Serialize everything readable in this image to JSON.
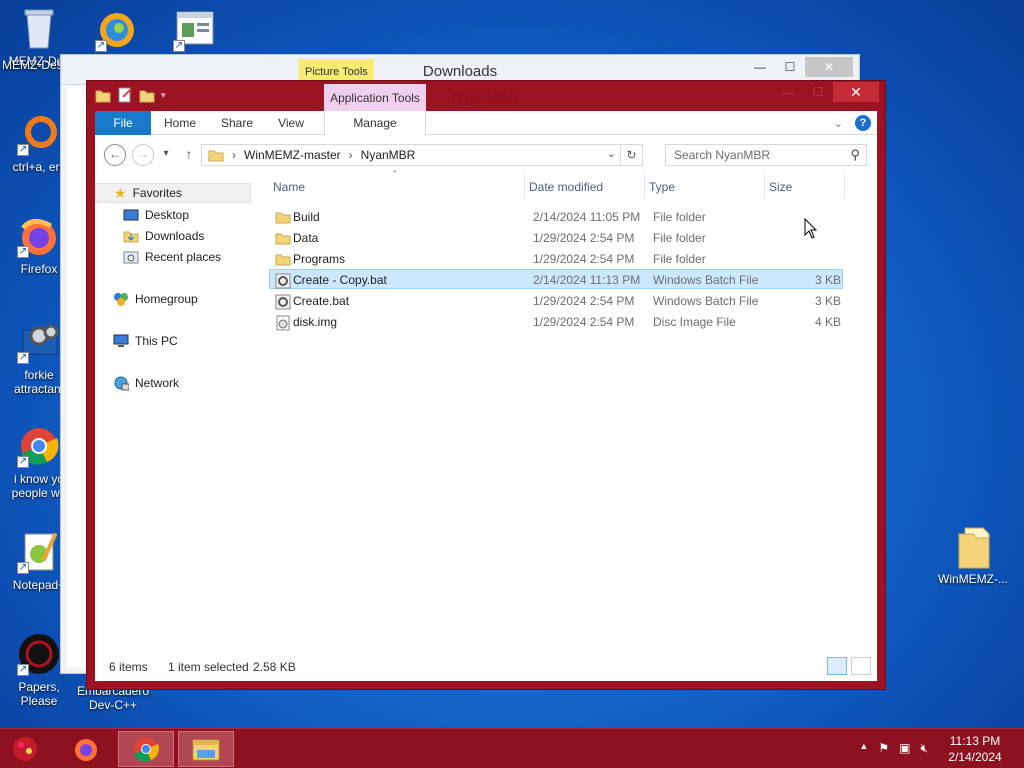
{
  "desktop": {
    "icons": [
      {
        "label": "MEMZ-Des"
      },
      {
        "label": "ctrl+a, ent"
      },
      {
        "label": "Firefox"
      },
      {
        "label": "forkie attractant"
      },
      {
        "label": "i know yo people we"
      },
      {
        "label": "Notepad+"
      },
      {
        "label": "Papers, Please"
      },
      {
        "label": "Embarcadero Dev-C++"
      },
      {
        "label": "WinMEMZ-..."
      }
    ]
  },
  "bg_window": {
    "title": "Downloads",
    "contextual_tab": "Picture Tools"
  },
  "window": {
    "title": "NyanMBR",
    "contextual_tab": "Application Tools",
    "ribbon_tabs": [
      "File",
      "Home",
      "Share",
      "View",
      "Manage"
    ],
    "breadcrumb": [
      "WinMEMZ-master",
      "NyanMBR"
    ],
    "search_placeholder": "Search NyanMBR",
    "nav": {
      "favorites": "Favorites",
      "desktop": "Desktop",
      "downloads": "Downloads",
      "recent": "Recent places",
      "homegroup": "Homegroup",
      "thispc": "This PC",
      "network": "Network"
    },
    "columns": {
      "name": "Name",
      "date": "Date modified",
      "type": "Type",
      "size": "Size"
    },
    "files": [
      {
        "name": "Build",
        "date": "2/14/2024 11:05 PM",
        "type": "File folder",
        "size": "",
        "icon": "folder-icon"
      },
      {
        "name": "Data",
        "date": "1/29/2024 2:54 PM",
        "type": "File folder",
        "size": "",
        "icon": "folder-icon"
      },
      {
        "name": "Programs",
        "date": "1/29/2024 2:54 PM",
        "type": "File folder",
        "size": "",
        "icon": "folder-icon"
      },
      {
        "name": "Create - Copy.bat",
        "date": "2/14/2024 11:13 PM",
        "type": "Windows Batch File",
        "size": "3 KB",
        "icon": "batch-file-icon",
        "selected": true
      },
      {
        "name": "Create.bat",
        "date": "1/29/2024 2:54 PM",
        "type": "Windows Batch File",
        "size": "3 KB",
        "icon": "batch-file-icon"
      },
      {
        "name": "disk.img",
        "date": "1/29/2024 2:54 PM",
        "type": "Disc Image File",
        "size": "4 KB",
        "icon": "disc-image-icon"
      }
    ],
    "status": {
      "count": "6 items",
      "selection": "1 item selected",
      "size": "2.58 KB"
    }
  },
  "taskbar": {
    "clock_time": "11:13 PM",
    "clock_date": "2/14/2024"
  },
  "colors": {
    "accent": "#9c1424",
    "ribbon_file": "#1979ca",
    "selection": "#cce8ff"
  }
}
